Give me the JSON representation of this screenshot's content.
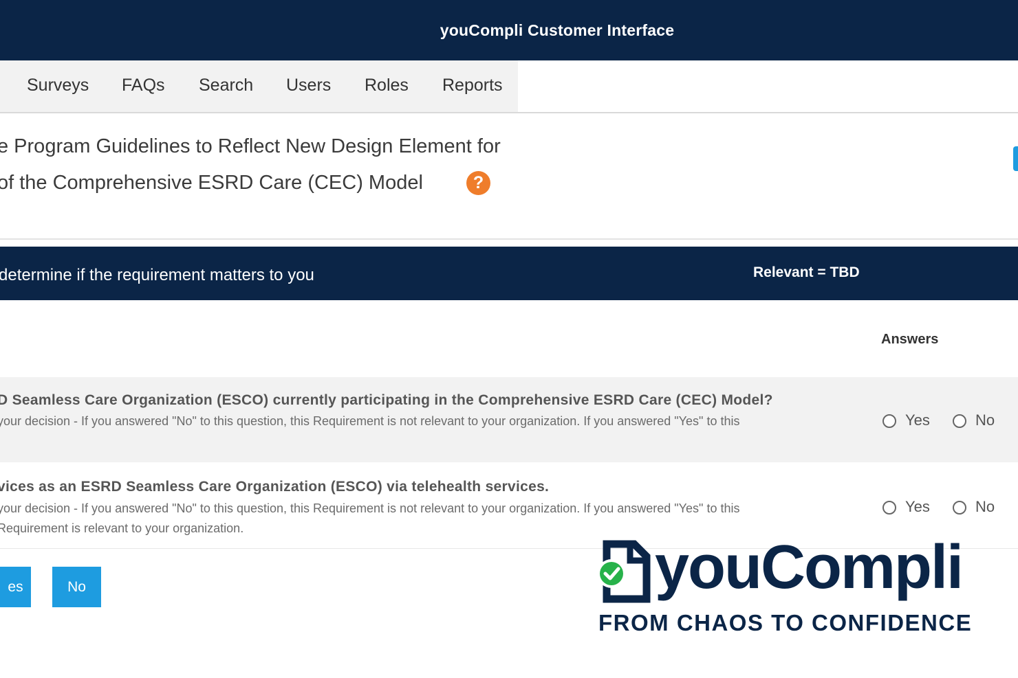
{
  "header": {
    "app_title": "youCompli Customer Interface"
  },
  "nav": {
    "items": [
      {
        "label": "Surveys"
      },
      {
        "label": "FAQs"
      },
      {
        "label": "Search"
      },
      {
        "label": "Users"
      },
      {
        "label": "Roles"
      },
      {
        "label": "Reports"
      }
    ]
  },
  "requirement": {
    "title_line1": "e Program Guidelines to Reflect New Design Element for",
    "title_line2": "of the Comprehensive ESRD Care (CEC) Model",
    "help_icon": "question-icon",
    "help_symbol": "?"
  },
  "section": {
    "instruction": "determine if the requirement matters to you",
    "relevant": "Relevant = TBD"
  },
  "answers_header": "Answers",
  "questions": [
    {
      "text": "D Seamless Care Organization (ESCO) currently participating in the Comprehensive ESRD Care (CEC) Model?",
      "hint_line1": "your decision - If you answered \"No\" to this question, this Requirement is not relevant to your organization. If you answered \"Yes\" to this",
      "hint_line2": "",
      "yes_label": "Yes",
      "no_label": "No"
    },
    {
      "text": "vices as an ESRD Seamless Care Organization (ESCO) via telehealth services.",
      "hint_line1": "your decision - If you answered \"No\" to this question, this Requirement is not relevant to your organization. If you answered \"Yes\" to this",
      "hint_line2": "Requirement is relevant to your organization.",
      "yes_label": "Yes",
      "no_label": "No"
    }
  ],
  "actions": {
    "yes_label": "es",
    "no_label": "No"
  },
  "branding": {
    "name": "youCompli",
    "tagline": "FROM CHAOS TO CONFIDENCE",
    "logo_icon": "document-check-icon",
    "colors": {
      "navy": "#0b2547",
      "accent_blue": "#1e9ce0",
      "check_green": "#27b24a",
      "help_orange": "#ef7d2b"
    }
  }
}
